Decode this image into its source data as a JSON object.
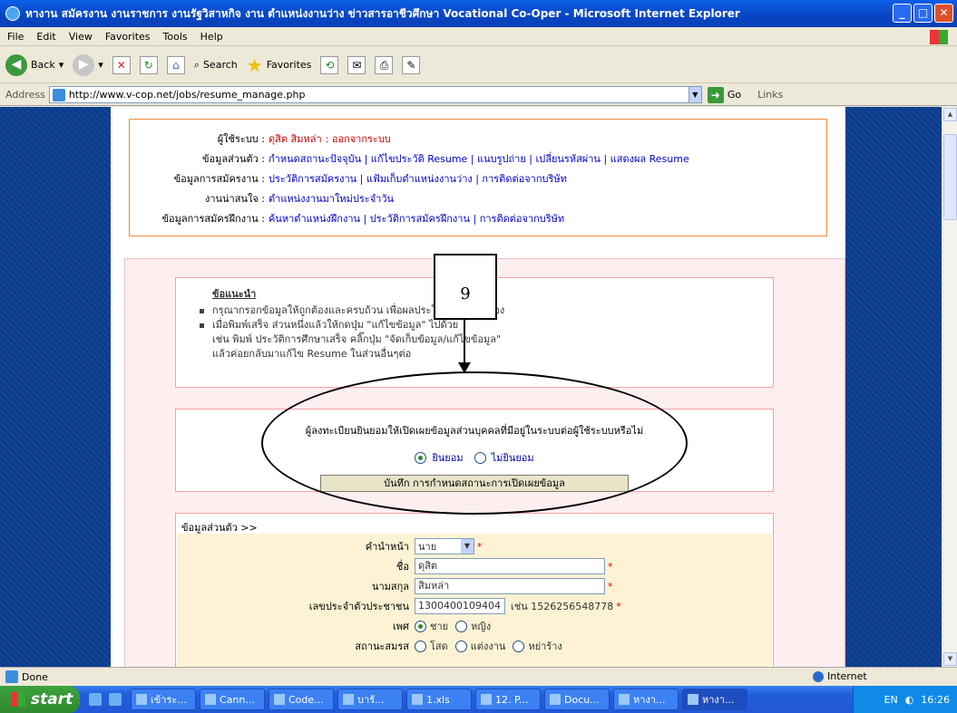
{
  "window": {
    "title": "หางาน สมัครงาน งานราชการ งานรัฐวิสาหกิจ งาน ตำแหน่งงานว่าง ข่าวสารอาชีวศึกษา Vocational Co-Oper - Microsoft Internet Explorer",
    "min": "_",
    "max": "□",
    "close": "✕"
  },
  "menu": [
    "File",
    "Edit",
    "View",
    "Favorites",
    "Tools",
    "Help"
  ],
  "toolbar": {
    "back": "Back",
    "search": "Search",
    "favorites": "Favorites"
  },
  "address": {
    "label": "Address",
    "url": "http://www.v-cop.net/jobs/resume_manage.php",
    "go": "Go",
    "links": "Links"
  },
  "user": {
    "system_label": "ผู้ใช้ระบบ :",
    "user_name": "ดุสิต สิมหล่า",
    "logout": ": ออกจากระบบ",
    "personal_label": "ข้อมูลส่วนตัว :",
    "personal_links": "กำหนดสถานะปัจจุบัน | แก้ไขประวัติ Resume | แนบรูปถ่าย | เปลี่ยนรหัสผ่าน | แสดงผล Resume",
    "apply_label": "ข้อมูลการสมัครงาน :",
    "apply_links": "ประวัติการสมัครงาน | แฟ้มเก็บตำแหน่งงานว่าง | การติดต่อจากบริษัท",
    "interest_label": "งานน่าสนใจ :",
    "interest_links": "ตำแหน่งงานมาใหม่ประจำวัน",
    "training_label": "ข้อมูลการสมัครฝึกงาน :",
    "training_links": "ค้นหาตำแหน่งฝึกงาน | ประวัติการสมัครฝึกงาน | การติดต่อจากบริษัท"
  },
  "advice": {
    "title": "ข้อแนะนำ",
    "line1": "กรุณากรอกข้อมูลให้ถูกต้องและครบถ้วน เพื่อผลประโยชน์ ตัวท่านเอง",
    "line2": "เมื่อพิมพ์เสร็จ ส่วนหนึ่งแล้วให้กดปุ่ม \"แก้ไขข้อมูล\" ไปด้วย",
    "line3": "เช่น พิมพ์ ประวัติการศึกษาเสร็จ คลิ๊กปุ่ม \"จัดเก็บข้อมูล/แก้ไขข้อมูล\"",
    "line4": "แล้วค่อยกลับมาแก้ไข Resume ในส่วนอื่นๆต่อ"
  },
  "consent": {
    "question": "ผู้ลงทะเบียนยินยอมให้เปิดเผยข้อมูลส่วนบุคคลที่มีอยู่ในระบบต่อผู้ใช้ระบบหรือไม่",
    "yes": "ยินยอม",
    "no": "ไม่ยินยอม",
    "save_button": "บันทึก การกำหนดสถานะการเปิดเผยข้อมูล"
  },
  "annotation": {
    "number": "9"
  },
  "personal": {
    "section_title": "ข้อมูลส่วนตัว >>",
    "prefix_label": "คำนำหน้า",
    "prefix_value": "นาย",
    "first_name_label": "ชื่อ",
    "first_name_value": "ดุสิต",
    "last_name_label": "นามสกุล",
    "last_name_value": "สิมหล่า",
    "id_label": "เลขประจำตัวประชาชน",
    "id_value": "1300400109404",
    "id_hint": "เช่น 1526256548778",
    "gender_label": "เพศ",
    "gender_male": "ชาย",
    "gender_female": "หญิง",
    "marital_label": "สถานะสมรส",
    "marital_single": "โสด",
    "marital_married": "แต่งงาน",
    "marital_divorced": "หย่าร้าง",
    "required_mark": "*"
  },
  "status": {
    "text": "Done",
    "zone": "Internet"
  },
  "taskbar": {
    "start": "start",
    "tasks": [
      "เข้าระ...",
      "Cann...",
      "Code...",
      "บารั...",
      "1.xls",
      "12. P...",
      "Docu...",
      "หางา...",
      "หางา..."
    ],
    "lang": "EN",
    "time": "16:26"
  }
}
